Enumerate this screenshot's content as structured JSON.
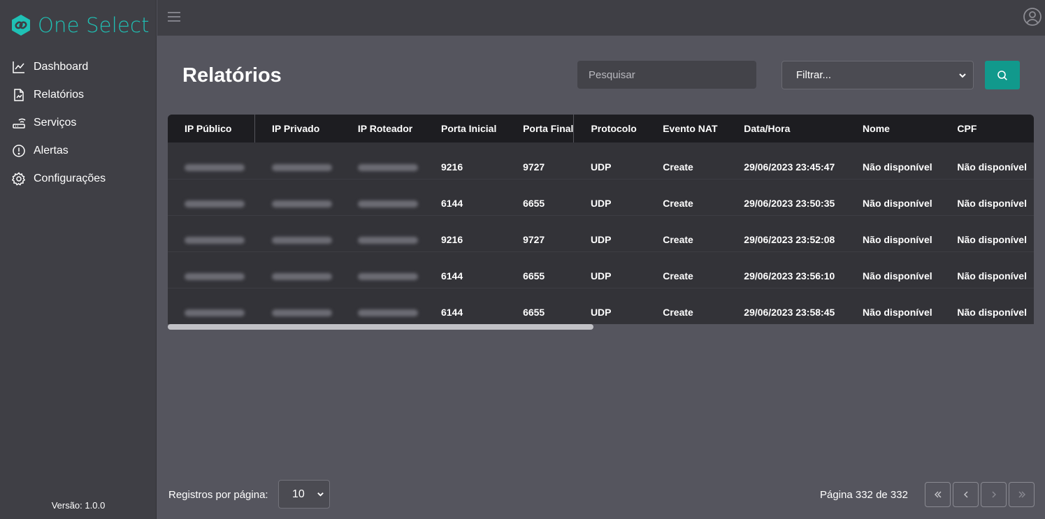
{
  "brand": {
    "name": "One Select",
    "color": "#1fc1b5"
  },
  "sidebar": {
    "items": [
      {
        "label": "Dashboard",
        "icon": "chart-line-icon"
      },
      {
        "label": "Relatórios",
        "icon": "file-chart-icon"
      },
      {
        "label": "Serviços",
        "icon": "router-icon"
      },
      {
        "label": "Alertas",
        "icon": "alert-circle-icon"
      },
      {
        "label": "Configurações",
        "icon": "gear-icon"
      }
    ],
    "version": "Versão: 1.0.0"
  },
  "topbar": {
    "menu_icon": "hamburger-icon",
    "user_icon": "user-circle-icon"
  },
  "main": {
    "title": "Relatórios",
    "search": {
      "placeholder": "Pesquisar",
      "value": ""
    },
    "filter": {
      "selected": "Filtrar..."
    },
    "search_button_icon": "search-icon",
    "accent": "#11998c"
  },
  "table": {
    "columns": [
      "IP Público",
      "IP Privado",
      "IP Roteador",
      "Porta Inicial",
      "Porta Final",
      "Protocolo",
      "Evento NAT",
      "Data/Hora",
      "Nome",
      "CPF"
    ],
    "rows": [
      {
        "porta_inicial": "9216",
        "porta_final": "9727",
        "protocolo": "UDP",
        "evento": "Create",
        "data_hora": "29/06/2023 23:45:47",
        "nome": "Não disponível",
        "cpf": "Não disponível"
      },
      {
        "porta_inicial": "6144",
        "porta_final": "6655",
        "protocolo": "UDP",
        "evento": "Create",
        "data_hora": "29/06/2023 23:50:35",
        "nome": "Não disponível",
        "cpf": "Não disponível"
      },
      {
        "porta_inicial": "9216",
        "porta_final": "9727",
        "protocolo": "UDP",
        "evento": "Create",
        "data_hora": "29/06/2023 23:52:08",
        "nome": "Não disponível",
        "cpf": "Não disponível"
      },
      {
        "porta_inicial": "6144",
        "porta_final": "6655",
        "protocolo": "UDP",
        "evento": "Create",
        "data_hora": "29/06/2023 23:56:10",
        "nome": "Não disponível",
        "cpf": "Não disponível"
      },
      {
        "porta_inicial": "6144",
        "porta_final": "6655",
        "protocolo": "UDP",
        "evento": "Create",
        "data_hora": "29/06/2023 23:58:45",
        "nome": "Não disponível",
        "cpf": "Não disponível"
      }
    ]
  },
  "pagination": {
    "rows_per_page_label": "Registros por página:",
    "rows_per_page": "10",
    "page_info": "Página 332 de 332",
    "buttons": [
      "first-page-icon",
      "previous-page-icon",
      "next-page-icon",
      "last-page-icon"
    ]
  }
}
